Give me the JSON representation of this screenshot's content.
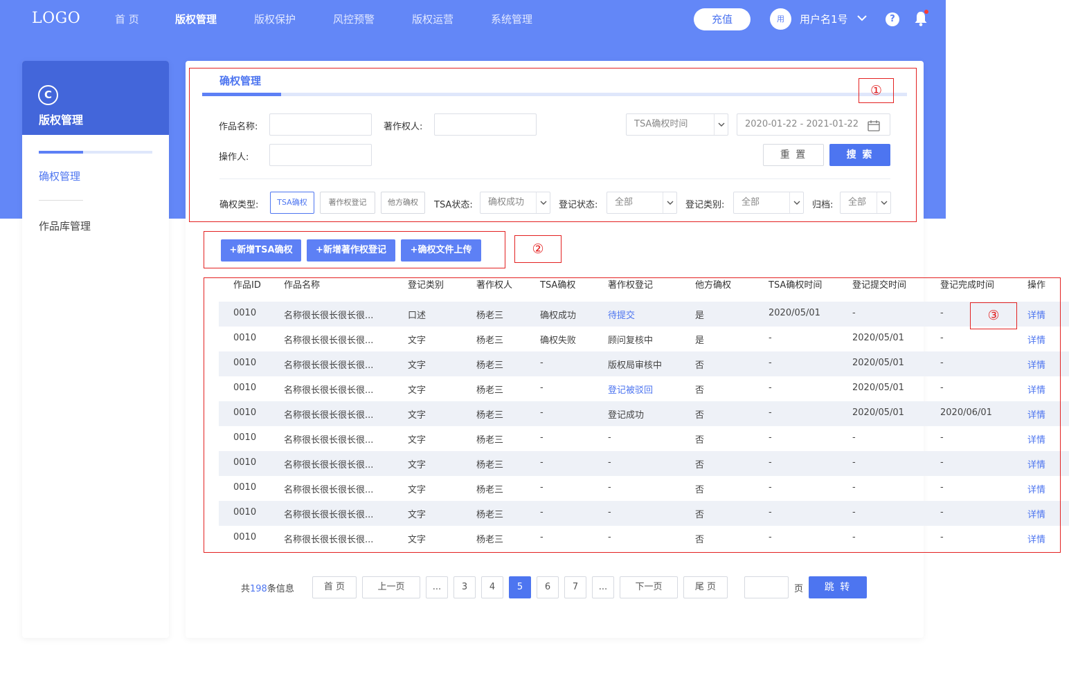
{
  "header": {
    "logo": "LOGO",
    "nav": [
      "首 页",
      "版权管理",
      "版权保护",
      "风控预警",
      "版权运营",
      "系统管理"
    ],
    "active_nav": "版权管理",
    "recharge": "充值",
    "avatar_text": "用",
    "username": "用户名1号",
    "help": "?"
  },
  "sidebar": {
    "icon_glyph": "C",
    "title": "版权管理",
    "items": [
      "确权管理",
      "作品库管理"
    ],
    "active_item": "确权管理"
  },
  "filters": {
    "tab": "确权管理",
    "work_name_label": "作品名称:",
    "copyright_owner_label": "著作权人:",
    "operator_label": "操作人:",
    "time_select": "TSA确权时间",
    "date_range": "2020-01-22 - 2021-01-22",
    "reset": "重 置",
    "search": "搜 索",
    "type_label": "确权类型:",
    "type_options": [
      "TSA确权",
      "著作权登记",
      "他方确权"
    ],
    "selected_type": "TSA确权",
    "tsa_status_label": "TSA状态:",
    "tsa_status_value": "确权成功",
    "reg_status_label": "登记状态:",
    "reg_status_value": "全部",
    "reg_category_label": "登记类别:",
    "reg_category_value": "全部",
    "archive_label": "归档:",
    "archive_value": "全部"
  },
  "actions": [
    "+新增TSA确权",
    "+新增著作权登记",
    "+确权文件上传"
  ],
  "table": {
    "columns": [
      "作品ID",
      "作品名称",
      "登记类别",
      "著作权人",
      "TSA确权",
      "著作权登记",
      "他方确权",
      "TSA确权时间",
      "登记提交时间",
      "登记完成时间",
      "操作"
    ],
    "rows": [
      [
        "0010",
        "名称很长很长很长很...",
        "口述",
        "杨老三",
        "确权成功",
        "待提交",
        "是",
        "2020/05/01",
        "-",
        "-",
        "详情"
      ],
      [
        "0010",
        "名称很长很长很长很...",
        "文字",
        "杨老三",
        "确权失败",
        "顾问复核中",
        "是",
        "-",
        "2020/05/01",
        "-",
        "详情"
      ],
      [
        "0010",
        "名称很长很长很长很...",
        "文字",
        "杨老三",
        "-",
        "版权局审核中",
        "否",
        "-",
        "2020/05/01",
        "-",
        "详情"
      ],
      [
        "0010",
        "名称很长很长很长很...",
        "文字",
        "杨老三",
        "-",
        "登记被驳回",
        "否",
        "-",
        "2020/05/01",
        "-",
        "详情"
      ],
      [
        "0010",
        "名称很长很长很长很...",
        "文字",
        "杨老三",
        "-",
        "登记成功",
        "否",
        "-",
        "2020/05/01",
        "2020/06/01",
        "详情"
      ],
      [
        "0010",
        "名称很长很长很长很...",
        "文字",
        "杨老三",
        "-",
        "-",
        "否",
        "-",
        "-",
        "-",
        "详情"
      ],
      [
        "0010",
        "名称很长很长很长很...",
        "文字",
        "杨老三",
        "-",
        "-",
        "否",
        "-",
        "-",
        "-",
        "详情"
      ],
      [
        "0010",
        "名称很长很长很长很...",
        "文字",
        "杨老三",
        "-",
        "-",
        "否",
        "-",
        "-",
        "-",
        "详情"
      ],
      [
        "0010",
        "名称很长很长很长很...",
        "文字",
        "杨老三",
        "-",
        "-",
        "否",
        "-",
        "-",
        "-",
        "详情"
      ],
      [
        "0010",
        "名称很长很长很长很...",
        "文字",
        "杨老三",
        "-",
        "-",
        "否",
        "-",
        "-",
        "-",
        "详情"
      ]
    ],
    "link_cells": [
      "待提交",
      "登记被驳回"
    ]
  },
  "pagination": {
    "total_prefix": "共",
    "total": "198",
    "total_suffix": "条信息",
    "buttons": [
      "首 页",
      "上一页",
      "...",
      "3",
      "4",
      "5",
      "6",
      "7",
      "...",
      "下一页",
      "尾 页"
    ],
    "current": "5",
    "page_unit": "页",
    "jump": "跳 转"
  },
  "annotations": [
    "①",
    "②",
    "③"
  ],
  "colors": {
    "primary": "#4d75f0",
    "header_bg": "#6387f7",
    "sidebar_head": "#4366da",
    "annotation": "#e32020"
  }
}
